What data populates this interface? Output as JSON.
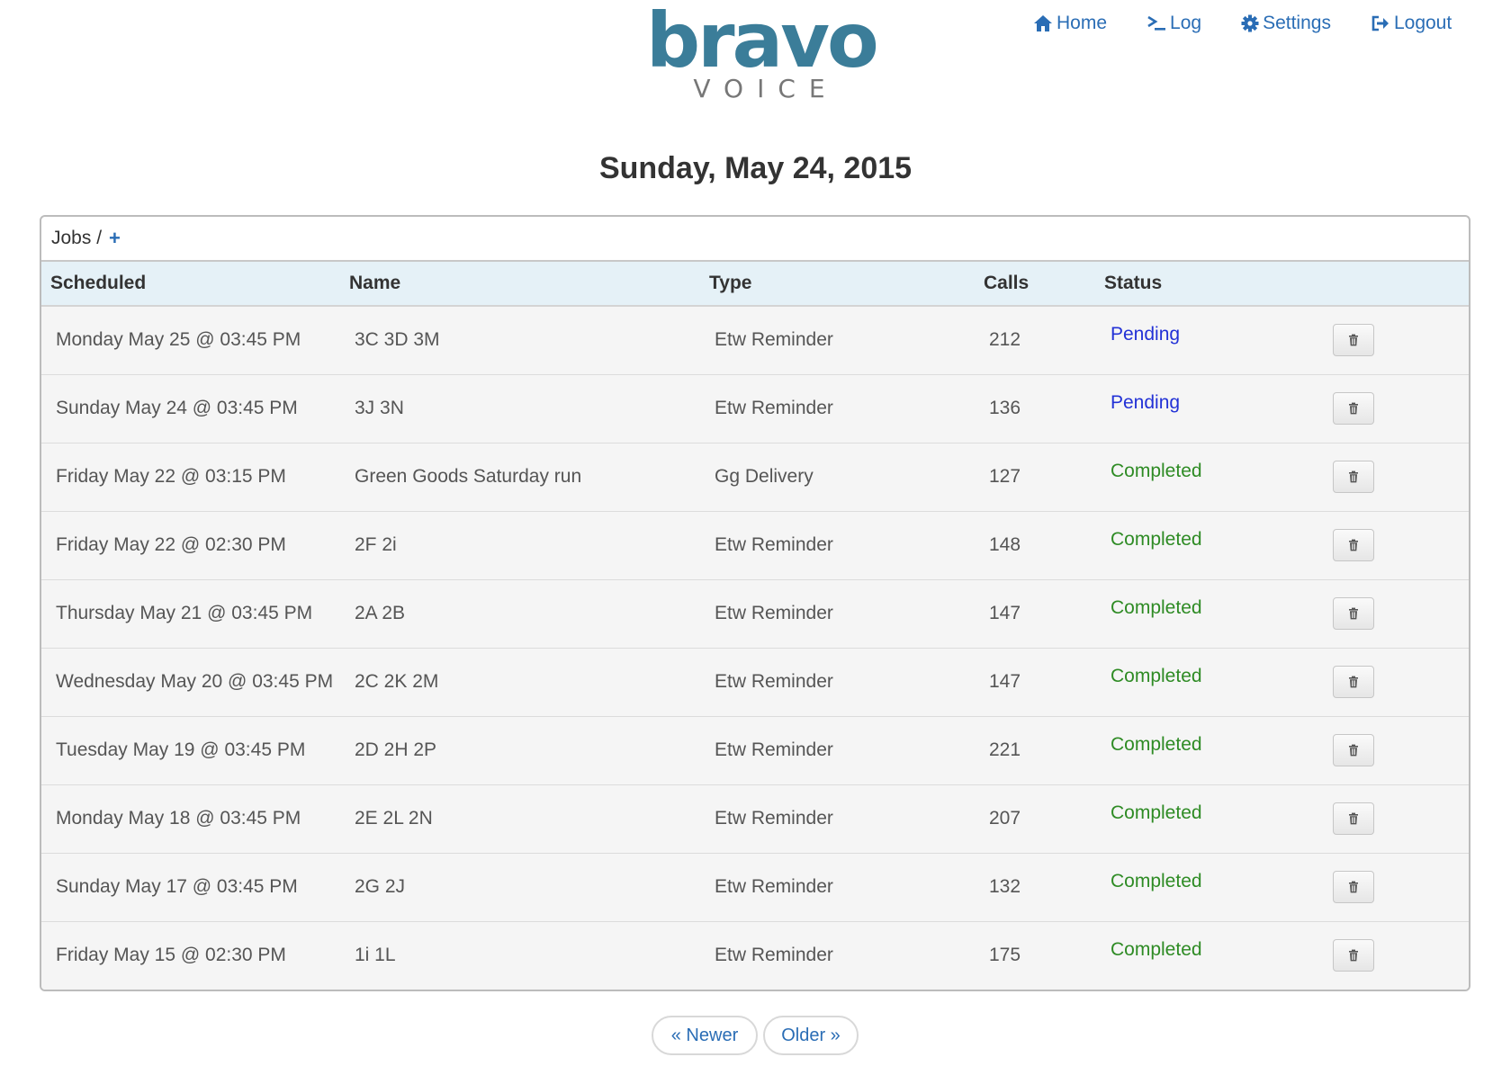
{
  "brand": {
    "word": "bravo",
    "sub": "VOICE"
  },
  "nav": {
    "home": "Home",
    "log": "Log",
    "settings": "Settings",
    "logout": "Logout"
  },
  "page_date": "Sunday, May 24, 2015",
  "panel": {
    "title": "Jobs /",
    "add_label": "+"
  },
  "table": {
    "headers": {
      "scheduled": "Scheduled",
      "name": "Name",
      "type": "Type",
      "calls": "Calls",
      "status": "Status"
    },
    "rows": [
      {
        "scheduled": "Monday May 25 @ 03:45 PM",
        "name": "3C 3D 3M",
        "type": "Etw Reminder",
        "calls": "212",
        "status": "Pending"
      },
      {
        "scheduled": "Sunday May 24 @ 03:45 PM",
        "name": "3J 3N",
        "type": "Etw Reminder",
        "calls": "136",
        "status": "Pending"
      },
      {
        "scheduled": "Friday May 22 @ 03:15 PM",
        "name": "Green Goods Saturday run",
        "type": "Gg Delivery",
        "calls": "127",
        "status": "Completed"
      },
      {
        "scheduled": "Friday May 22 @ 02:30 PM",
        "name": "2F 2i",
        "type": "Etw Reminder",
        "calls": "148",
        "status": "Completed"
      },
      {
        "scheduled": "Thursday May 21 @ 03:45 PM",
        "name": "2A 2B",
        "type": "Etw Reminder",
        "calls": "147",
        "status": "Completed"
      },
      {
        "scheduled": "Wednesday May 20 @ 03:45 PM",
        "name": "2C 2K 2M",
        "type": "Etw Reminder",
        "calls": "147",
        "status": "Completed"
      },
      {
        "scheduled": "Tuesday May 19 @ 03:45 PM",
        "name": "2D 2H 2P",
        "type": "Etw Reminder",
        "calls": "221",
        "status": "Completed"
      },
      {
        "scheduled": "Monday May 18 @ 03:45 PM",
        "name": "2E 2L 2N",
        "type": "Etw Reminder",
        "calls": "207",
        "status": "Completed"
      },
      {
        "scheduled": "Sunday May 17 @ 03:45 PM",
        "name": "2G 2J",
        "type": "Etw Reminder",
        "calls": "132",
        "status": "Completed"
      },
      {
        "scheduled": "Friday May 15 @ 02:30 PM",
        "name": "1i 1L",
        "type": "Etw Reminder",
        "calls": "175",
        "status": "Completed"
      }
    ],
    "delete_icon": "trash-icon"
  },
  "pagination": {
    "newer": "« Newer",
    "older": "Older »"
  },
  "colors": {
    "brand": "#3b7d99",
    "link": "#2a6db5",
    "pending": "#2231d6",
    "completed": "#2e8b24",
    "header_row": "#e5f1f7"
  }
}
